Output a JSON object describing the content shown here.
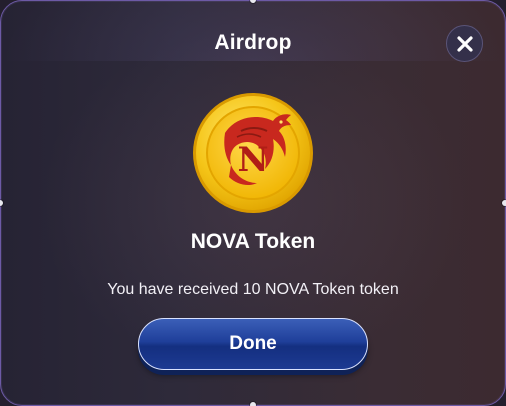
{
  "dialog": {
    "title": "Airdrop",
    "close_icon": "close-icon",
    "token_icon": "nova-token-coin-icon",
    "token_name": "NOVA Token",
    "message": "You have received 10 NOVA Token token",
    "done_label": "Done",
    "coin_letter": "N"
  },
  "colors": {
    "accent_button": "#1f3f9a",
    "coin_gold": "#f5c518",
    "dragon_red": "#c8281e",
    "border": "#6d5aa6"
  }
}
